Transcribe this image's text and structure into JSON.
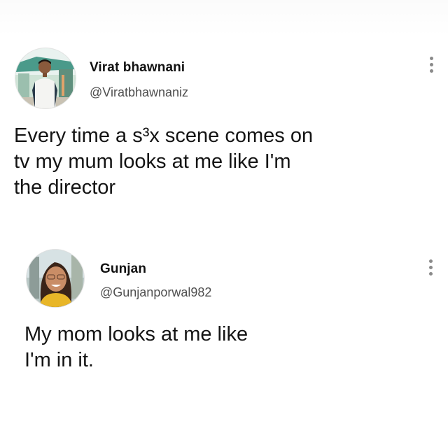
{
  "posts": [
    {
      "author_name": "Virat bhawnani",
      "author_handle": "@Viratbhawnaniz",
      "text": "Every time a s³x scene comes on\ntv my mum looks at me like I'm\nthe director",
      "avatar_icon": "profile-photo",
      "menu_icon": "more-vertical-icon"
    },
    {
      "author_name": "Gunjan",
      "author_handle": "@Gunjanporwal982",
      "text": "My mom looks at me like\nI'm in it.",
      "avatar_icon": "profile-photo",
      "menu_icon": "more-vertical-icon"
    }
  ],
  "colors": {
    "text": "#141414",
    "handle": "#4f4f4f",
    "menu_dots": "#8a8a8a",
    "background": "#ffffff"
  }
}
